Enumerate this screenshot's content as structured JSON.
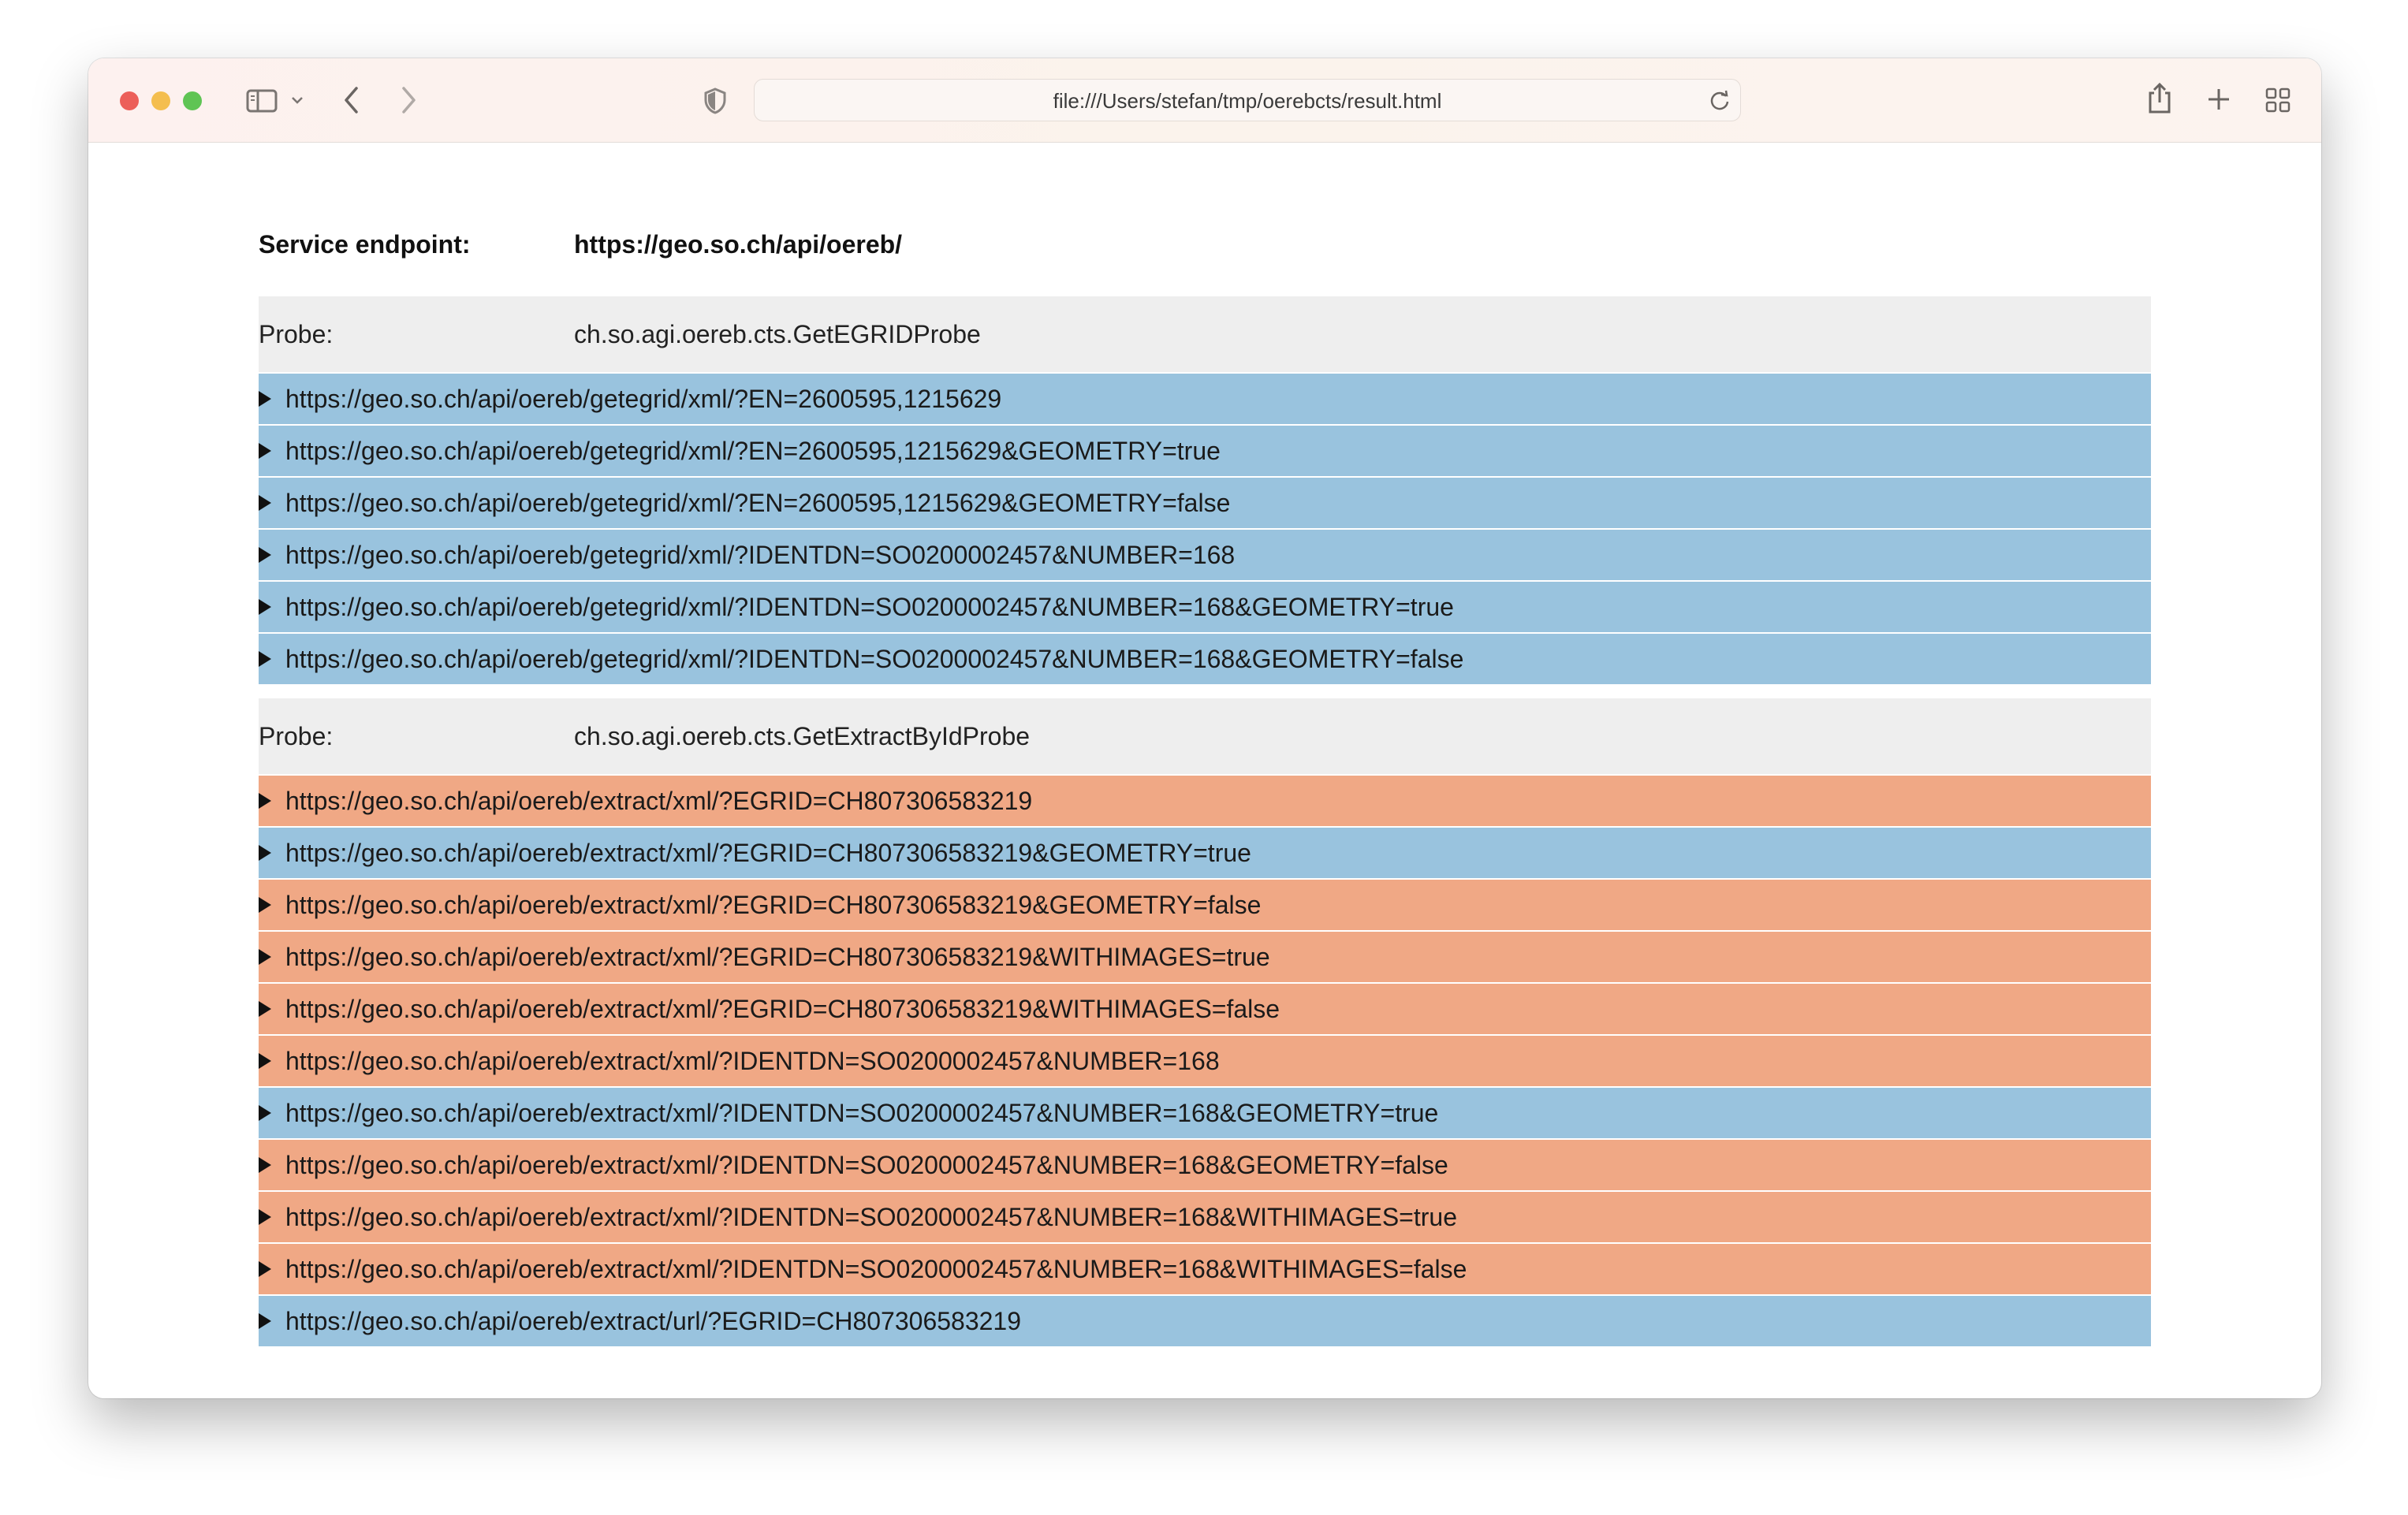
{
  "browser": {
    "address": "file:///Users/stefan/tmp/oerebcts/result.html"
  },
  "endpoint": {
    "label": "Service endpoint:",
    "value": "https://geo.so.ch/api/oereb/"
  },
  "colors": {
    "ok": "#99c3de",
    "fail": "#f0a885",
    "probe_header_bg": "#eeeeee"
  },
  "probes": [
    {
      "label": "Probe:",
      "name": "ch.so.agi.oereb.cts.GetEGRIDProbe",
      "requests": [
        {
          "url": "https://geo.so.ch/api/oereb/getegrid/xml/?EN=2600595,1215629",
          "status": "ok"
        },
        {
          "url": "https://geo.so.ch/api/oereb/getegrid/xml/?EN=2600595,1215629&GEOMETRY=true",
          "status": "ok"
        },
        {
          "url": "https://geo.so.ch/api/oereb/getegrid/xml/?EN=2600595,1215629&GEOMETRY=false",
          "status": "ok"
        },
        {
          "url": "https://geo.so.ch/api/oereb/getegrid/xml/?IDENTDN=SO0200002457&NUMBER=168",
          "status": "ok"
        },
        {
          "url": "https://geo.so.ch/api/oereb/getegrid/xml/?IDENTDN=SO0200002457&NUMBER=168&GEOMETRY=true",
          "status": "ok"
        },
        {
          "url": "https://geo.so.ch/api/oereb/getegrid/xml/?IDENTDN=SO0200002457&NUMBER=168&GEOMETRY=false",
          "status": "ok"
        }
      ]
    },
    {
      "label": "Probe:",
      "name": "ch.so.agi.oereb.cts.GetExtractByIdProbe",
      "requests": [
        {
          "url": "https://geo.so.ch/api/oereb/extract/xml/?EGRID=CH807306583219",
          "status": "fail"
        },
        {
          "url": "https://geo.so.ch/api/oereb/extract/xml/?EGRID=CH807306583219&GEOMETRY=true",
          "status": "ok"
        },
        {
          "url": "https://geo.so.ch/api/oereb/extract/xml/?EGRID=CH807306583219&GEOMETRY=false",
          "status": "fail"
        },
        {
          "url": "https://geo.so.ch/api/oereb/extract/xml/?EGRID=CH807306583219&WITHIMAGES=true",
          "status": "fail"
        },
        {
          "url": "https://geo.so.ch/api/oereb/extract/xml/?EGRID=CH807306583219&WITHIMAGES=false",
          "status": "fail"
        },
        {
          "url": "https://geo.so.ch/api/oereb/extract/xml/?IDENTDN=SO0200002457&NUMBER=168",
          "status": "fail"
        },
        {
          "url": "https://geo.so.ch/api/oereb/extract/xml/?IDENTDN=SO0200002457&NUMBER=168&GEOMETRY=true",
          "status": "ok"
        },
        {
          "url": "https://geo.so.ch/api/oereb/extract/xml/?IDENTDN=SO0200002457&NUMBER=168&GEOMETRY=false",
          "status": "fail"
        },
        {
          "url": "https://geo.so.ch/api/oereb/extract/xml/?IDENTDN=SO0200002457&NUMBER=168&WITHIMAGES=true",
          "status": "fail"
        },
        {
          "url": "https://geo.so.ch/api/oereb/extract/xml/?IDENTDN=SO0200002457&NUMBER=168&WITHIMAGES=false",
          "status": "fail"
        },
        {
          "url": "https://geo.so.ch/api/oereb/extract/url/?EGRID=CH807306583219",
          "status": "ok"
        }
      ]
    }
  ]
}
